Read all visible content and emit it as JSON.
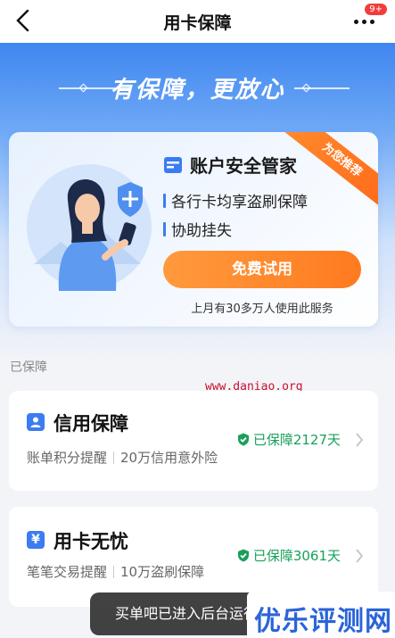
{
  "nav": {
    "title": "用卡保障",
    "badge": "9+",
    "back_icon": "back-arrow-icon",
    "more_icon": "more-dots-icon"
  },
  "hero": {
    "slogan": "有保障，更放心"
  },
  "promo": {
    "title": "账户安全管家",
    "ribbon": "为您推荐",
    "features": [
      "各行卡均享盗刷保障",
      "协助挂失"
    ],
    "button": "免费试用",
    "users": "上月有30多万人使用此服务"
  },
  "section": {
    "label": "已保障"
  },
  "watermark": "www.daniao.org",
  "items": [
    {
      "name": "信用保障",
      "icon": "user-card-icon",
      "desc_a": "账单积分提醒",
      "desc_b": "20万信用意外险",
      "status": "已保障2127天"
    },
    {
      "name": "用卡无忧",
      "icon": "yuan-card-icon",
      "desc_a": "笔笔交易提醒",
      "desc_b": "10万盗刷保障",
      "status": "已保障3061天"
    }
  ],
  "toast": "买单吧已进入后台运行",
  "brand_watermark": "优乐评测网",
  "colors": {
    "accent": "#3b7cf0",
    "orange": "#ff7a1f",
    "green": "#19a05a"
  }
}
